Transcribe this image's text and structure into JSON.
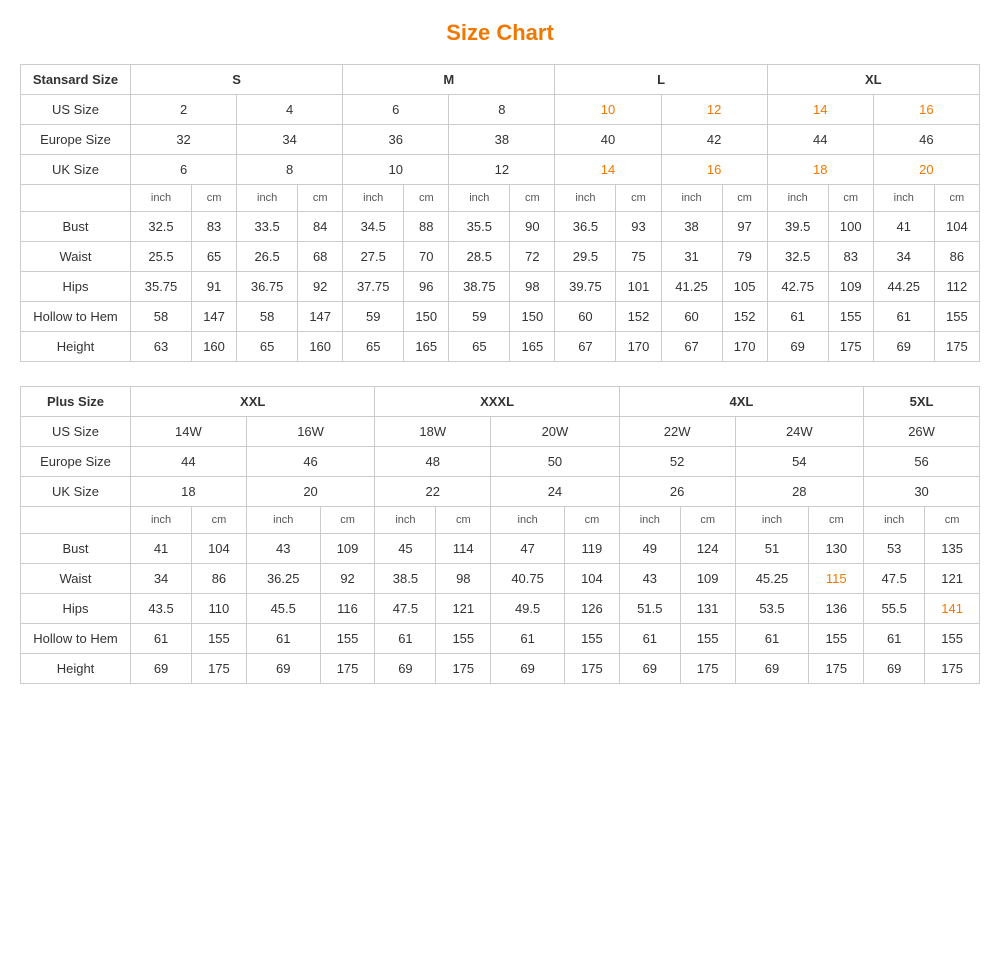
{
  "title": "Size Chart",
  "standard_table": {
    "header_label": "Stansard Size",
    "size_groups": [
      "S",
      "M",
      "L",
      "XL"
    ],
    "us_size_label": "US Size",
    "us_sizes": [
      "2",
      "4",
      "6",
      "8",
      "10",
      "12",
      "14",
      "16"
    ],
    "europe_size_label": "Europe Size",
    "europe_sizes": [
      "32",
      "34",
      "36",
      "38",
      "40",
      "42",
      "44",
      "46"
    ],
    "uk_size_label": "UK Size",
    "uk_sizes": [
      "6",
      "8",
      "10",
      "12",
      "14",
      "16",
      "18",
      "20"
    ],
    "measurement_labels": [
      "inch",
      "cm",
      "inch",
      "cm",
      "inch",
      "cm",
      "inch",
      "cm",
      "inch",
      "cm",
      "inch",
      "cm",
      "inch",
      "cm",
      "inch",
      "cm"
    ],
    "measurements": [
      {
        "label": "Bust",
        "values": [
          "32.5",
          "83",
          "33.5",
          "84",
          "34.5",
          "88",
          "35.5",
          "90",
          "36.5",
          "93",
          "38",
          "97",
          "39.5",
          "100",
          "41",
          "104"
        ]
      },
      {
        "label": "Waist",
        "values": [
          "25.5",
          "65",
          "26.5",
          "68",
          "27.5",
          "70",
          "28.5",
          "72",
          "29.5",
          "75",
          "31",
          "79",
          "32.5",
          "83",
          "34",
          "86"
        ]
      },
      {
        "label": "Hips",
        "values": [
          "35.75",
          "91",
          "36.75",
          "92",
          "37.75",
          "96",
          "38.75",
          "98",
          "39.75",
          "101",
          "41.25",
          "105",
          "42.75",
          "109",
          "44.25",
          "112"
        ]
      },
      {
        "label": "Hollow to Hem",
        "values": [
          "58",
          "147",
          "58",
          "147",
          "59",
          "150",
          "59",
          "150",
          "60",
          "152",
          "60",
          "152",
          "61",
          "155",
          "61",
          "155"
        ]
      },
      {
        "label": "Height",
        "values": [
          "63",
          "160",
          "65",
          "160",
          "65",
          "165",
          "65",
          "165",
          "67",
          "170",
          "67",
          "170",
          "69",
          "175",
          "69",
          "175"
        ]
      }
    ]
  },
  "plus_table": {
    "header_label": "Plus Size",
    "size_groups": [
      "XXL",
      "XXXL",
      "4XL",
      "5XL"
    ],
    "us_size_label": "US Size",
    "us_sizes": [
      "14W",
      "16W",
      "18W",
      "20W",
      "22W",
      "24W",
      "26W"
    ],
    "europe_size_label": "Europe Size",
    "europe_sizes": [
      "44",
      "46",
      "48",
      "50",
      "52",
      "54",
      "56"
    ],
    "uk_size_label": "UK Size",
    "uk_sizes": [
      "18",
      "20",
      "22",
      "24",
      "26",
      "28",
      "30"
    ],
    "measurement_labels": [
      "inch",
      "cm",
      "inch",
      "cm",
      "inch",
      "cm",
      "inch",
      "cm",
      "inch",
      "cm",
      "inch",
      "cm",
      "inch",
      "cm"
    ],
    "measurements": [
      {
        "label": "Bust",
        "values": [
          "41",
          "104",
          "43",
          "109",
          "45",
          "114",
          "47",
          "119",
          "49",
          "124",
          "51",
          "130",
          "53",
          "135"
        ]
      },
      {
        "label": "Waist",
        "values": [
          "34",
          "86",
          "36.25",
          "92",
          "38.5",
          "98",
          "40.75",
          "104",
          "43",
          "109",
          "45.25",
          "115",
          "47.5",
          "121"
        ]
      },
      {
        "label": "Hips",
        "values": [
          "43.5",
          "110",
          "45.5",
          "116",
          "47.5",
          "121",
          "49.5",
          "126",
          "51.5",
          "131",
          "53.5",
          "136",
          "55.5",
          "141"
        ]
      },
      {
        "label": "Hollow to Hem",
        "values": [
          "61",
          "155",
          "61",
          "155",
          "61",
          "155",
          "61",
          "155",
          "61",
          "155",
          "61",
          "155",
          "61",
          "155"
        ]
      },
      {
        "label": "Height",
        "values": [
          "69",
          "175",
          "69",
          "175",
          "69",
          "175",
          "69",
          "175",
          "69",
          "175",
          "69",
          "175",
          "69",
          "175"
        ]
      }
    ]
  }
}
